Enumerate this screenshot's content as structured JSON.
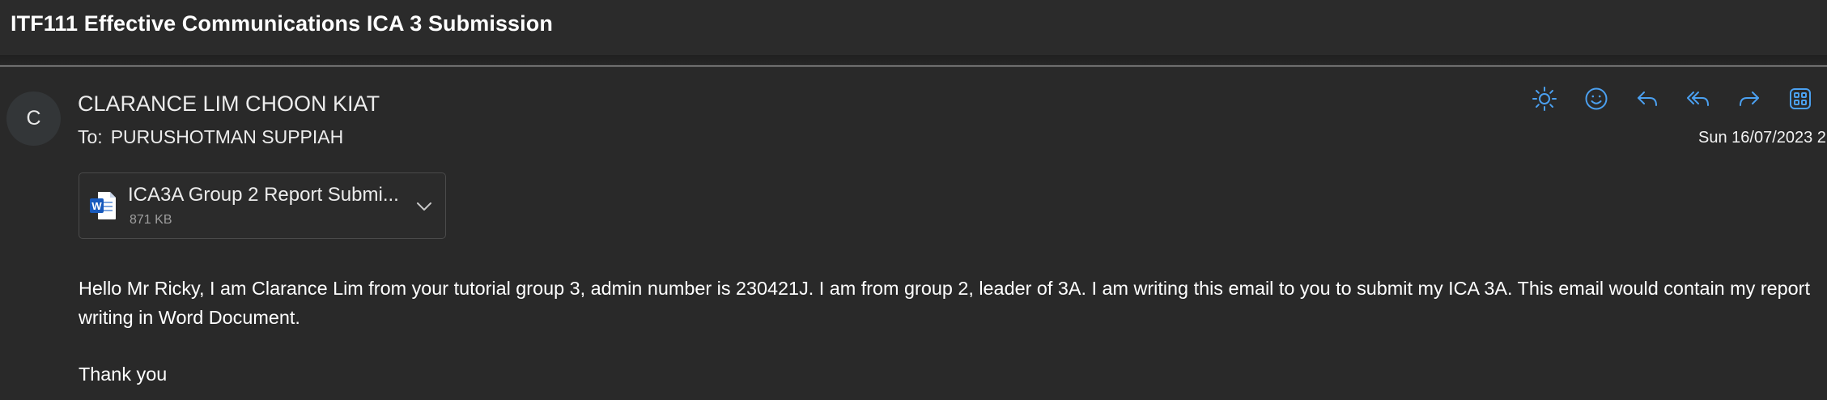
{
  "subject": {
    "title": "ITF111 Effective Communications ICA 3 Submission"
  },
  "message": {
    "avatar_initial": "C",
    "sender": "CLARANCE LIM CHOON KIAT",
    "to_label": "To:",
    "to_value": "PURUSHOTMAN SUPPIAH",
    "date": "Sun 16/07/2023 2",
    "actions": [
      {
        "name": "brightness-icon"
      },
      {
        "name": "emoji-icon"
      },
      {
        "name": "reply-icon"
      },
      {
        "name": "reply-all-icon"
      },
      {
        "name": "forward-icon"
      },
      {
        "name": "apps-icon"
      }
    ],
    "accent_color": "#4ba0f0"
  },
  "attachment": {
    "name": "ICA3A Group 2 Report Submi...",
    "size": "871 KB",
    "icon": "word-document-icon"
  },
  "body": {
    "paragraph": "Hello Mr Ricky, I am Clarance Lim from your tutorial group 3, admin number is 230421J. I am from group 2, leader of 3A. I am writing this email to you to submit my ICA 3A. This email would contain my report writing in Word Document.",
    "closing": "Thank you"
  }
}
